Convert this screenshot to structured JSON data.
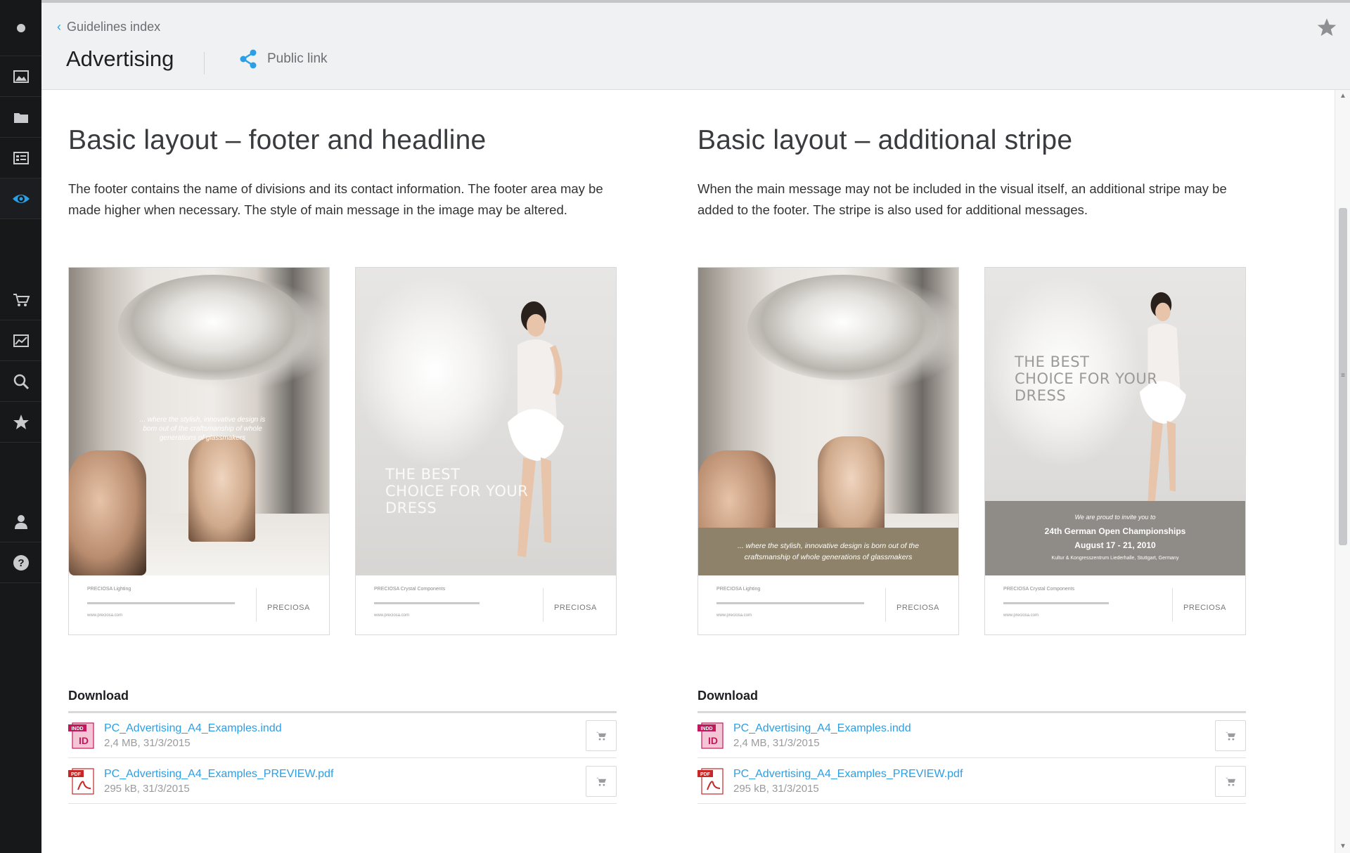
{
  "header": {
    "breadcrumb": "Guidelines index",
    "title": "Advertising",
    "public_link": "Public link"
  },
  "sidebar": {
    "items": [
      {
        "icon": "dot-icon"
      },
      {
        "icon": "images-icon"
      },
      {
        "icon": "folder-icon"
      },
      {
        "icon": "list-icon"
      },
      {
        "icon": "eye-icon",
        "active": true
      },
      {
        "icon": "cart-icon"
      },
      {
        "icon": "stats-icon"
      },
      {
        "icon": "search-icon"
      },
      {
        "icon": "star-icon"
      },
      {
        "icon": "user-icon"
      },
      {
        "icon": "help-icon"
      }
    ]
  },
  "sections": [
    {
      "title": "Basic layout – footer and headline",
      "description": "The footer contains the name of divisions and its contact information. The footer area may be made higher when necessary. The style of main message in the image may be altered.",
      "posters": [
        {
          "tagline": "... where the stylish, innovative design is born out of the craftsmanship of whole generations of glassmakers",
          "footer_company": "PRECIOSA Lighting",
          "footer_web": "www.preciosa.com",
          "logo": "PRECIOSA"
        },
        {
          "slogan": "THE BEST CHOICE FOR YOUR DRESS",
          "footer_company": "PRECIOSA Crystal Components",
          "footer_web": "www.preciosa.com",
          "logo": "PRECIOSA"
        }
      ],
      "download": {
        "title": "Download",
        "files": [
          {
            "type": "INDD",
            "name": "PC_Advertising_A4_Examples.indd",
            "meta": "2,4 MB, 31/3/2015"
          },
          {
            "type": "PDF",
            "name": "PC_Advertising_A4_Examples_PREVIEW.pdf",
            "meta": "295 kB, 31/3/2015"
          }
        ]
      }
    },
    {
      "title": "Basic layout – additional stripe",
      "description": "When the main message may not be included in the visual itself, an additional stripe may be added to the footer. The stripe is also used for additional messages.",
      "posters": [
        {
          "tagline": "... where the stylish, innovative design is born out of the craftsmanship of whole generations of glassmakers",
          "footer_company": "PRECIOSA Lighting",
          "footer_web": "www.preciosa.com",
          "logo": "PRECIOSA"
        },
        {
          "slogan": "THE BEST CHOICE FOR YOUR DRESS",
          "invite": "We are proud to invite you to",
          "event": "24th German Open Championships",
          "dates": "August 17 - 21, 2010",
          "venue": "Kultur & Kongresszentrum Liederhalle, Stuttgart, Germany",
          "footer_company": "PRECIOSA Crystal Components",
          "footer_web": "www.preciosa.com",
          "logo": "PRECIOSA"
        }
      ],
      "download": {
        "title": "Download",
        "files": [
          {
            "type": "INDD",
            "name": "PC_Advertising_A4_Examples.indd",
            "meta": "2,4 MB, 31/3/2015"
          },
          {
            "type": "PDF",
            "name": "PC_Advertising_A4_Examples_PREVIEW.pdf",
            "meta": "295 kB, 31/3/2015"
          }
        ]
      }
    }
  ],
  "colors": {
    "accent": "#2b9fe6",
    "sidebar_bg": "#17181a",
    "header_bg": "#f0f1f3",
    "indd_icon": "#c2185b",
    "pdf_icon": "#c62828"
  }
}
